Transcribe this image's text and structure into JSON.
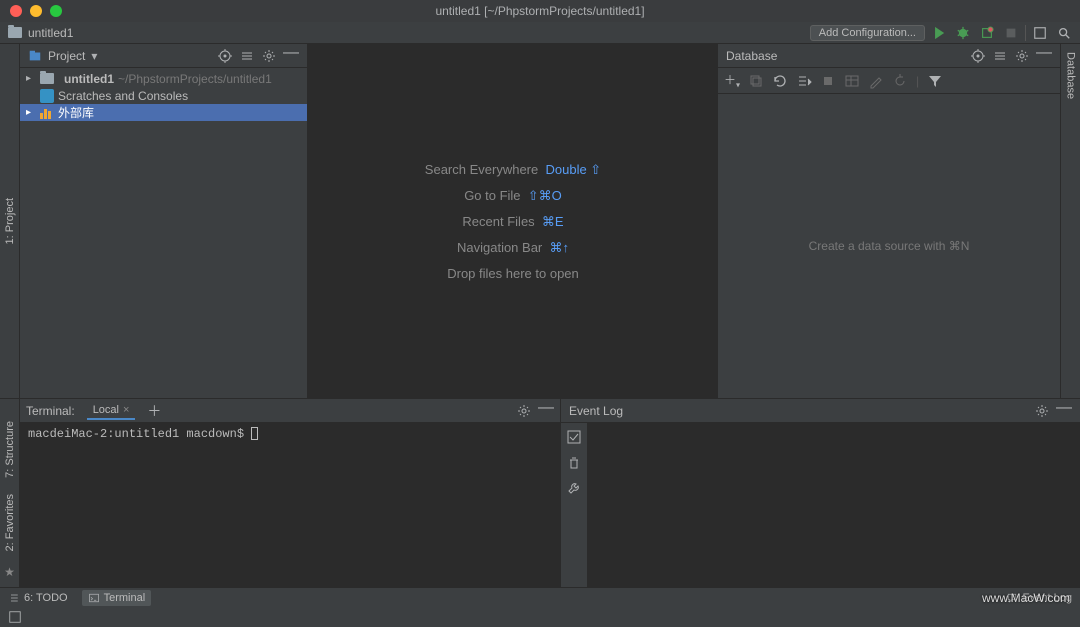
{
  "window": {
    "title": "untitled1 [~/PhpstormProjects/untitled1]"
  },
  "breadcrumb": {
    "root": "untitled1"
  },
  "toolbar": {
    "add_configuration": "Add Configuration..."
  },
  "rails": {
    "project": "1: Project",
    "database": "Database",
    "structure": "7: Structure",
    "favorites": "2: Favorites"
  },
  "project_panel": {
    "label": "Project",
    "items": {
      "root": {
        "name": "untitled1",
        "path": "~/PhpstormProjects/untitled1"
      },
      "scratches": "Scratches and Consoles",
      "external": "外部库"
    }
  },
  "editor": {
    "hints": {
      "search": "Search Everywhere",
      "search_key": "Double ⇧",
      "goto": "Go to File",
      "goto_key": "⇧⌘O",
      "recent": "Recent Files",
      "recent_key": "⌘E",
      "nav": "Navigation Bar",
      "nav_key": "⌘↑",
      "drop": "Drop files here to open"
    }
  },
  "database": {
    "label": "Database",
    "empty": "Create a data source with ⌘N"
  },
  "terminal": {
    "label": "Terminal:",
    "tab": "Local",
    "prompt": "macdeiMac-2:untitled1 macdown$ "
  },
  "eventlog": {
    "label": "Event Log"
  },
  "bottom": {
    "todo": "6: TODO",
    "terminal": "Terminal",
    "eventlog": "Event Log"
  },
  "watermark": "www.MacW.com"
}
